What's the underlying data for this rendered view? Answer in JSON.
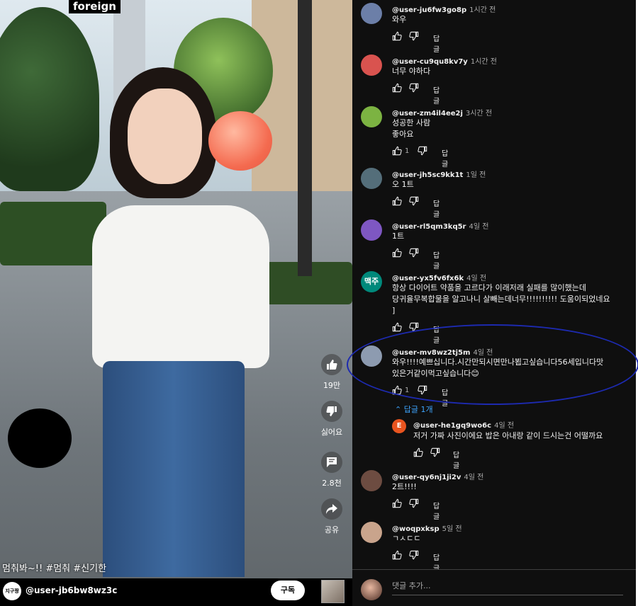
{
  "video": {
    "overlay_tag": "foreign",
    "caption": "멈춰봐~!! #멈춰 #신기한",
    "channel_avatar_text": "지구짱",
    "channel_handle": "@user-jb6bw8wz3c",
    "subscribe_label": "구독",
    "actions": {
      "like_count": "19만",
      "dislike_label": "싫어요",
      "comment_count": "2.8천",
      "share_label": "공유"
    }
  },
  "comments": {
    "reply_label": "답글",
    "add_comment_placeholder": "댓글 추가...",
    "items": [
      {
        "username": "@user-ju6fw3go8p",
        "time": "1시간 전",
        "text": "와우",
        "likes": "",
        "avatar_text": "",
        "avatar_color": "#6c7fa8"
      },
      {
        "username": "@user-cu9qu8kv7y",
        "time": "1시간 전",
        "text": "너무 야하다",
        "likes": "",
        "avatar_text": "",
        "avatar_color": "#d9534f"
      },
      {
        "username": "@user-zm4il4ee2j",
        "time": "3시간 전",
        "text": "성공한 사람\n좋아요",
        "likes": "1",
        "avatar_text": "",
        "avatar_color": "#7cb342"
      },
      {
        "username": "@user-jh5sc9kk1t",
        "time": "1일 전",
        "text": "오 1트",
        "likes": "",
        "avatar_text": "",
        "avatar_color": "#546e7a"
      },
      {
        "username": "@user-rl5qm3kq5r",
        "time": "4일 전",
        "text": "1트",
        "likes": "",
        "avatar_text": "",
        "avatar_color": "#7e57c2"
      },
      {
        "username": "@user-yx5fv6fx6k",
        "time": "4일 전",
        "text": "항상 다이어트 약품을 고르다가 이래저래 실패를 많이했는데\n당귀율무복합물을 알고나니 살빼는데너무!!!!!!!!!! 도움이되었네요\n]",
        "likes": "",
        "avatar_text": "맥주",
        "avatar_color": "#00897b"
      },
      {
        "username": "@user-mv8wz2tj5m",
        "time": "4일 전",
        "text": "와우!!!!예쁘십니다.시간만되시면만나뵙고싶습니다56세입니다맛\n있은거같이먹고싶습니다😊",
        "likes": "1",
        "avatar_text": "",
        "avatar_color": "#8d9bb0"
      },
      {
        "username": "@user-qy6nj1ji2v",
        "time": "4일 전",
        "text": "2트!!!!",
        "likes": "",
        "avatar_text": "",
        "avatar_color": "#6d4c41"
      },
      {
        "username": "@woqpxksp",
        "time": "5일 전",
        "text": "ㄱㅅㄷㄷ",
        "likes": "",
        "avatar_text": "",
        "avatar_color": "#c9a48c"
      }
    ],
    "replies_toggle": "답글 1개",
    "reply": {
      "username": "@user-he1gq9wo6c",
      "time": "4일 전",
      "text": "저거 가짜 사진이에요 밥은 아내랑 같이 드시는건 어떨까요",
      "avatar_text": "E",
      "avatar_color": "#e8541f"
    }
  }
}
